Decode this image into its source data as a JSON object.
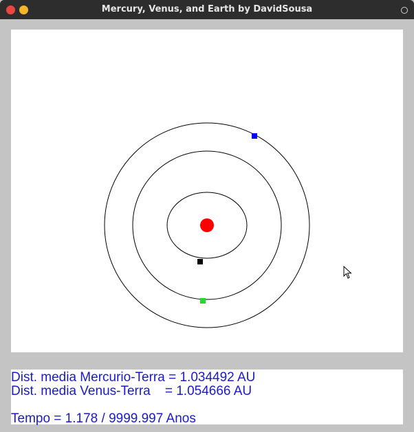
{
  "window": {
    "title": "Mercury, Venus, and Earth by DavidSousa"
  },
  "info": {
    "line1": "Dist. media Mercurio-Terra = 1.034492 AU",
    "line2": "Dist. media Venus-Terra    = 1.054666 AU",
    "line3": "Tempo = 1.178 / 9999.997 Anos"
  },
  "colors": {
    "sun": "#ff0000",
    "mercury": "#000000",
    "venus": "#22dd22",
    "earth": "#0000ee",
    "text": "#1a1acc"
  }
}
